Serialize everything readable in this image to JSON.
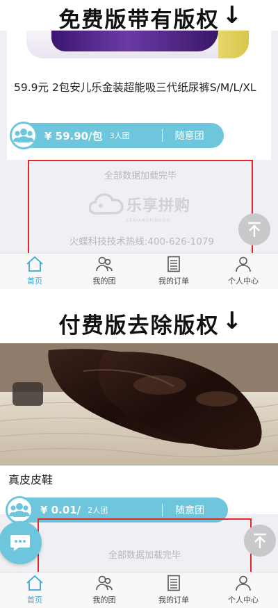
{
  "free_section": {
    "heading": "免费版带有版权",
    "arrow": "↓"
  },
  "paid_section": {
    "heading": "付费版去除版权",
    "arrow": "↓"
  },
  "top_product": {
    "name": "59.9元 2包安儿乐金装超能吸三代纸尿裤S/M/L/XL",
    "price": "¥ 59.90/包",
    "group_size": "3人团",
    "join_any": "随意团"
  },
  "bottom_product": {
    "name": "真皮皮鞋",
    "price": "¥ 0.01/",
    "group_size": "2人团",
    "join_any": "随意团"
  },
  "list_footer": {
    "all_loaded": "全部数据加载完毕",
    "brand_logo": "乐享拼购",
    "brand_logo_sub": "LEXIANGPINGOU",
    "hotline": "火蝶科技技术热线:400-626-1079"
  },
  "tabbar": {
    "items": [
      {
        "label": "首页",
        "icon": "home-icon"
      },
      {
        "label": "我的团",
        "icon": "group-icon"
      },
      {
        "label": "我的订单",
        "icon": "order-list-icon"
      },
      {
        "label": "个人中心",
        "icon": "profile-icon"
      }
    ]
  },
  "colors": {
    "accent": "#6ec6dc",
    "highlight_box": "#e8242b",
    "tab_active": "#3aa7d6",
    "page_bg": "#efeff4"
  }
}
